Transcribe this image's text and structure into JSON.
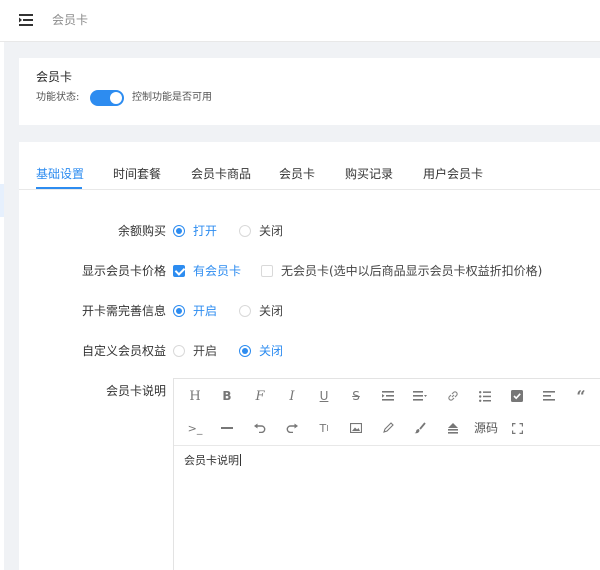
{
  "header": {
    "breadcrumb": "会员卡"
  },
  "status_card": {
    "title": "会员卡",
    "status_label": "功能状态:",
    "enabled": true,
    "description": "控制功能是否可用"
  },
  "tabs": [
    {
      "label": "基础设置",
      "active": true
    },
    {
      "label": "时间套餐",
      "active": false
    },
    {
      "label": "会员卡商品",
      "active": false
    },
    {
      "label": "会员卡",
      "active": false
    },
    {
      "label": "购买记录",
      "active": false
    },
    {
      "label": "用户会员卡",
      "active": false
    }
  ],
  "form": {
    "balance_purchase": {
      "label": "余额购买",
      "options": [
        "打开",
        "关闭"
      ],
      "selected": "打开"
    },
    "show_price": {
      "label": "显示会员卡价格",
      "options": [
        "有会员卡",
        "无会员卡(选中以后商品显示会员卡权益折扣价格)"
      ],
      "checked": "有会员卡"
    },
    "complete_info": {
      "label": "开卡需完善信息",
      "options": [
        "开启",
        "关闭"
      ],
      "selected": "开启"
    },
    "custom_rights": {
      "label": "自定义会员权益",
      "options": [
        "开启",
        "关闭"
      ],
      "selected": "关闭"
    },
    "description": {
      "label": "会员卡说明",
      "content": "会员卡说明",
      "toolbar_source_label": "源码",
      "toolbar_icons": [
        "heading-icon",
        "bold-icon",
        "font-icon",
        "italic-icon",
        "underline-icon",
        "strikethrough-icon",
        "indent-icon",
        "list-style-icon",
        "link-icon",
        "bullet-list-icon",
        "checkbox-icon",
        "align-icon",
        "quote-icon",
        "code-icon",
        "hr-icon",
        "undo-icon",
        "redo-icon",
        "text-size-icon",
        "image-icon",
        "pen-icon",
        "brush-icon",
        "eraser-icon",
        "fullscreen-icon"
      ]
    }
  },
  "colors": {
    "accent": "#2d8cf0",
    "background": "#f0f2f5"
  }
}
